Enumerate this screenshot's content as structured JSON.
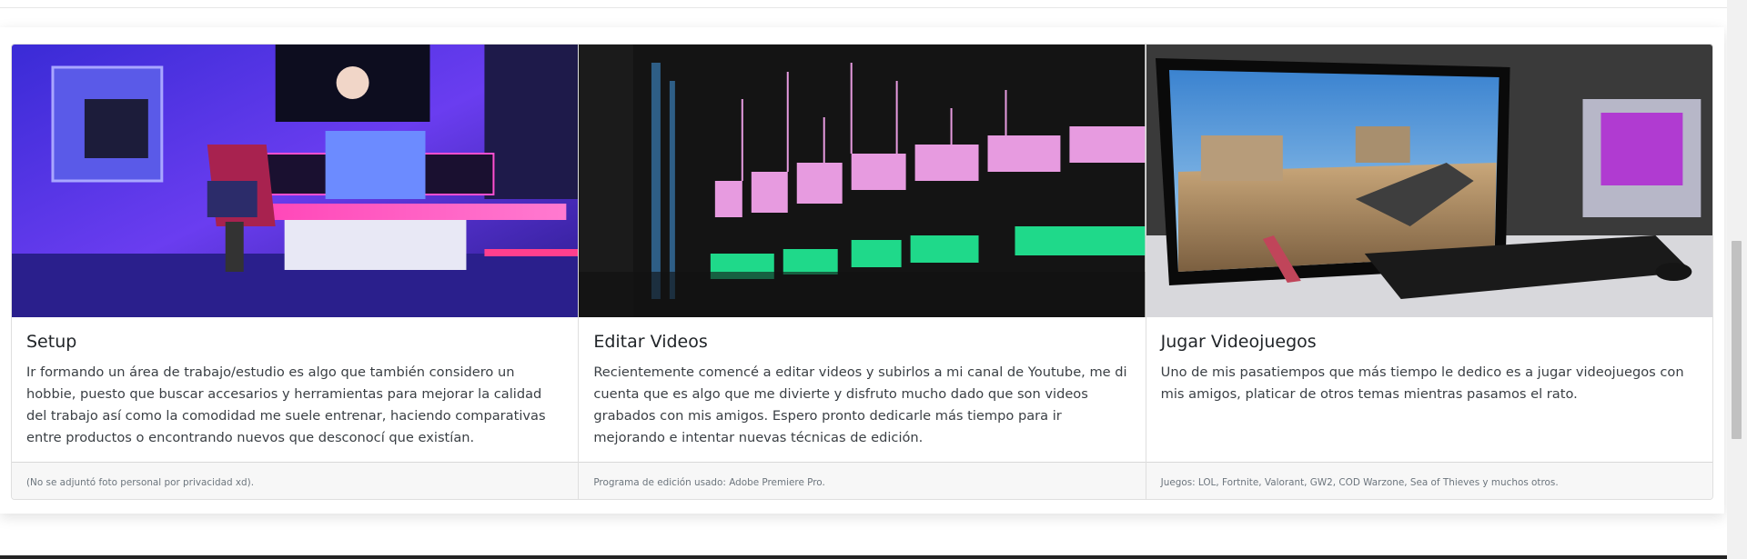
{
  "cards": [
    {
      "image": "gaming-setup-photo",
      "title": "Setup",
      "text": "Ir formando un área de trabajo/estudio es algo que también considero un hobbie, puesto que buscar accesarios y herramientas para mejorar la calidad del trabajo así como la comodidad me suele entrenar, haciendo comparativas entre productos o encontrando nuevos que desconocí que existían.",
      "footer": "(No se adjuntó foto personal por privacidad xd)."
    },
    {
      "image": "video-editing-timeline-photo",
      "title": "Editar Videos",
      "text": "Recientemente comencé a editar videos y subirlos a mi canal de Youtube, me di cuenta que es algo que me divierte y disfruto mucho dado que son videos grabados con mis amigos. Espero pronto dedicarle más tiempo para ir mejorando e intentar nuevas técnicas de edición.",
      "footer": "Programa de edición usado: Adobe Premiere Pro."
    },
    {
      "image": "videogame-monitor-photo",
      "title": "Jugar Videojuegos",
      "text": "Uno de mis pasatiempos que más tiempo le dedico es a jugar videojuegos con mis amigos, platicar de otros temas mientras pasamos el rato.",
      "footer": "Juegos: LOL, Fortnite, Valorant, GW2, COD Warzone, Sea of Thieves y muchos otros."
    }
  ],
  "colors": {
    "neon_blue": "#4f46ff",
    "neon_pink": "#ff2fb0",
    "timeline_green": "#1fd98a",
    "timeline_pink": "#e79be0"
  }
}
